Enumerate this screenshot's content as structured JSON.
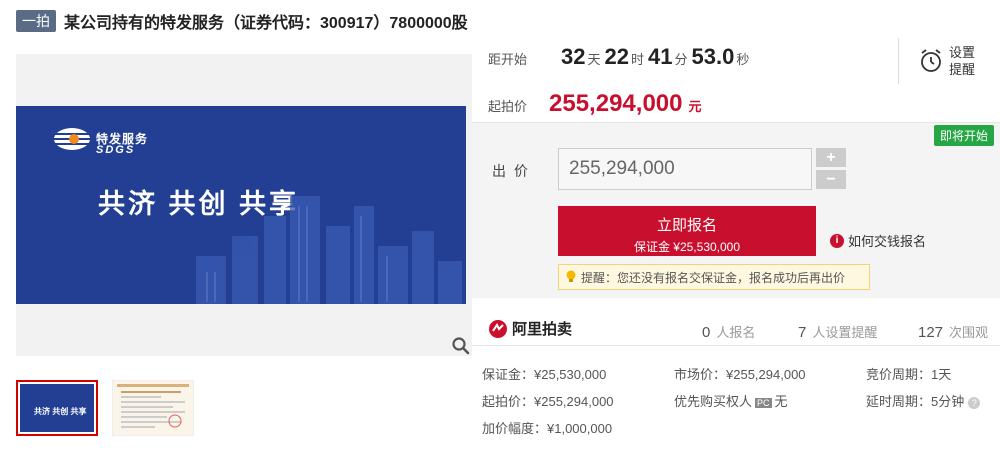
{
  "header": {
    "tag": "一拍",
    "title": "某公司持有的特发服务（证券代码：300917）7800000股"
  },
  "banner": {
    "logo_text": "特发服务",
    "logo_sub": "SDGS",
    "slogan": "共济  共创  共享",
    "thumb_slogan": "共济 共创 共享"
  },
  "countdown": {
    "label": "距开始",
    "days": "32",
    "days_unit": "天",
    "hours": "22",
    "hours_unit": "时",
    "minutes": "41",
    "minutes_unit": "分",
    "seconds": "53.0",
    "seconds_unit": "秒"
  },
  "reminder": {
    "line1": "设置",
    "line2": "提醒"
  },
  "start_price": {
    "label": "起拍价",
    "value": "255,294,000",
    "unit": "元"
  },
  "status_badge": "即将开始",
  "bid": {
    "label": "出价",
    "value": "255,294,000",
    "plus": "+",
    "minus": "−"
  },
  "register": {
    "title": "立即报名",
    "deposit": "保证金 ¥25,530,000"
  },
  "how_to": "如何交钱报名",
  "tip": "提醒：您还没有报名交保证金，报名成功后再出价",
  "brand": {
    "name": "阿里拍卖"
  },
  "stats": {
    "signups": "0",
    "signups_label": "人报名",
    "reminders": "7",
    "reminders_label": "人设置提醒",
    "views": "127",
    "views_label": "次围观"
  },
  "details": {
    "deposit": "保证金：¥25,530,000",
    "market_price": "市场价：¥255,294,000",
    "cycle": "竞价周期：1天",
    "start_price": "起拍价：¥255,294,000",
    "priority_label": "优先购买权人",
    "priority_tag": "PC",
    "priority_value": "无",
    "delay": "延时周期：5分钟",
    "increment": "加价幅度：¥1,000,000"
  },
  "colors": {
    "accent": "#c8102e",
    "banner": "#223f94",
    "badge": "#27a645"
  }
}
